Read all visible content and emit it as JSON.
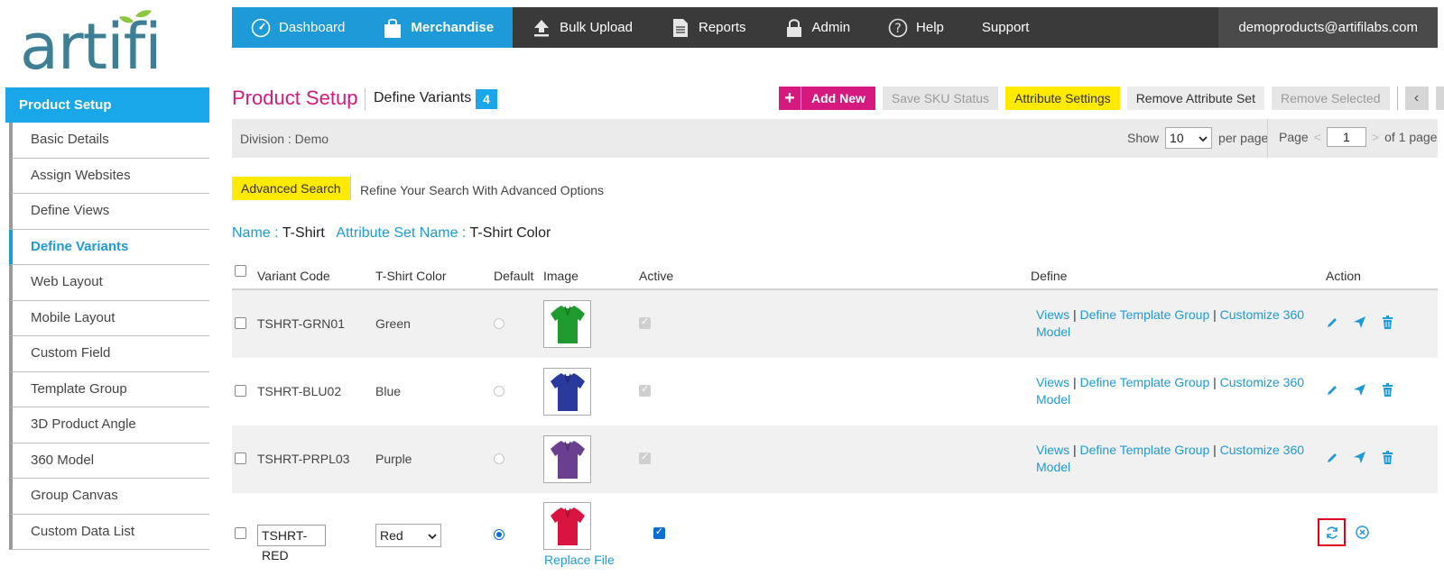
{
  "brand": {
    "logo_text": "artifi",
    "accent": "#1d9ad7",
    "logo_leaf": "#8dc63f",
    "logo_text_color": "#3f7f95"
  },
  "topnav": {
    "items": [
      {
        "label": "Dashboard",
        "icon": "speedometer-icon"
      },
      {
        "label": "Merchandise",
        "icon": "shopping-bag-icon"
      },
      {
        "label": "Bulk Upload",
        "icon": "upload-icon"
      },
      {
        "label": "Reports",
        "icon": "document-icon"
      },
      {
        "label": "Admin",
        "icon": "lock-icon"
      },
      {
        "label": "Help",
        "icon": "help-icon"
      },
      {
        "label": "Support",
        "icon": ""
      }
    ],
    "user_email": "demoproducts@artifilabs.com"
  },
  "sidebar": {
    "header": "Product Setup",
    "items": [
      {
        "label": "Basic Details"
      },
      {
        "label": "Assign Websites"
      },
      {
        "label": "Define Views"
      },
      {
        "label": "Define Variants"
      },
      {
        "label": "Web Layout"
      },
      {
        "label": "Mobile Layout"
      },
      {
        "label": "Custom Field"
      },
      {
        "label": "Template Group"
      },
      {
        "label": "3D Product Angle"
      },
      {
        "label": "360 Model"
      },
      {
        "label": "Group Canvas"
      },
      {
        "label": "Custom Data List"
      }
    ],
    "active_index": 3
  },
  "header": {
    "title": "Product Setup",
    "subtitle": "Define Variants",
    "count": "4"
  },
  "toolbar": {
    "add_new": "Add New",
    "save_sku": "Save SKU Status",
    "attribute_settings": "Attribute Settings",
    "remove_attribute_set": "Remove Attribute Set",
    "remove_selected": "Remove Selected",
    "prev": "‹",
    "next": "›"
  },
  "division": {
    "label": "Division :  Demo",
    "show_label": "Show",
    "per_page_value": "10",
    "per_page_label": "per page",
    "page_label": "Page",
    "page_prev": "<",
    "page_value": "1",
    "page_next": ">",
    "of_pages": "of 1 page"
  },
  "advanced_search": {
    "button": "Advanced Search",
    "hint": "Refine Your Search With Advanced Options"
  },
  "filter": {
    "name_label": "Name : ",
    "name_value": "T-Shirt",
    "attr_label": "Attribute Set Name : ",
    "attr_value": "T-Shirt Color"
  },
  "table": {
    "columns": [
      "Variant Code",
      "T-Shirt Color",
      "Default",
      "Image",
      "Active",
      "Define",
      "Action"
    ],
    "rows": [
      {
        "code": "TSHRT-GRN01",
        "color": "Green",
        "swatch": "#1f9a2e",
        "default": false,
        "active": true
      },
      {
        "code": "TSHRT-BLU02",
        "color": "Blue",
        "swatch": "#2a3a9c",
        "default": false,
        "active": true
      },
      {
        "code": "TSHRT-PRPL03",
        "color": "Purple",
        "swatch": "#6a3f8f",
        "default": false,
        "active": true
      }
    ],
    "define_links": {
      "views": "Views",
      "template_group": "Define Template Group",
      "customize_360": "Customize 360",
      "model": "Model",
      "sep": "|"
    },
    "edit_row": {
      "code": "TSHRT-RED",
      "color": "Red",
      "swatch": "#d8143f",
      "default": true,
      "active": true,
      "replace_file": "Replace File"
    }
  }
}
